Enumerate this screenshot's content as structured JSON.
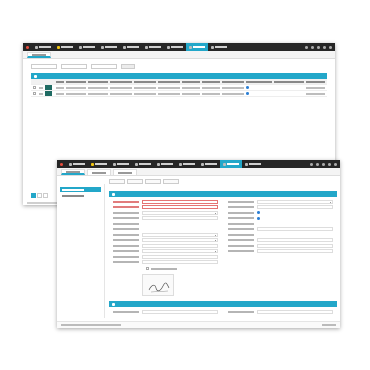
{
  "colors": {
    "topbar": "#262626",
    "accent": "#23a7c9",
    "logo": "#e74c3c",
    "warning_icon": "#f1c40f",
    "swatch": "#1f6b63",
    "status_dot": "#2b7fd4",
    "required": "#e17c7c"
  },
  "icons": {
    "logo": "logo-icon",
    "menu": "menu-icon",
    "warning": "warning-icon",
    "header": "panel-header-icon",
    "status": "status-dot-icon",
    "signature": "signature-icon"
  },
  "back_window": {
    "menu_item_count": 9,
    "active_menu_index": 7,
    "top_icon_count": 5,
    "sub_tab_count": 1,
    "filter_input_count": 3,
    "filter_button_count": 1,
    "table_header_cell_count": 12,
    "rows": [
      {
        "selected": false,
        "swatch": true,
        "status_dot": true
      },
      {
        "selected": false,
        "swatch": true,
        "status_dot": true
      }
    ],
    "page_count": 3,
    "current_page": 1
  },
  "front_window": {
    "menu_item_count": 9,
    "active_menu_index": 7,
    "top_icon_count": 5,
    "sub_tab_count": 3,
    "active_sub_tab": 0,
    "sidebar_item_count": 2,
    "active_sidebar_item": 0,
    "toolbar_button_count": 4,
    "left_fields": [
      {
        "required": true,
        "control": "input",
        "error": true
      },
      {
        "required": true,
        "control": "input",
        "error": true
      },
      {
        "required": false,
        "control": "select"
      },
      {
        "required": false,
        "control": "input"
      },
      {
        "required": false,
        "control": "none"
      },
      {
        "required": false,
        "control": "none"
      },
      {
        "required": false,
        "control": "select"
      },
      {
        "required": false,
        "control": "select"
      },
      {
        "required": false,
        "control": "input"
      },
      {
        "required": false,
        "control": "select"
      },
      {
        "required": false,
        "control": "input"
      },
      {
        "required": false,
        "control": "input"
      }
    ],
    "right_fields": [
      {
        "control": "select"
      },
      {
        "control": "input"
      },
      {
        "control": "radio"
      },
      {
        "control": "radio"
      },
      {
        "control": "none"
      },
      {
        "control": "input"
      },
      {
        "control": "none"
      },
      {
        "control": "input"
      },
      {
        "control": "input"
      },
      {
        "control": "input"
      }
    ],
    "has_signature_box": true,
    "second_section_field_count": 2
  }
}
